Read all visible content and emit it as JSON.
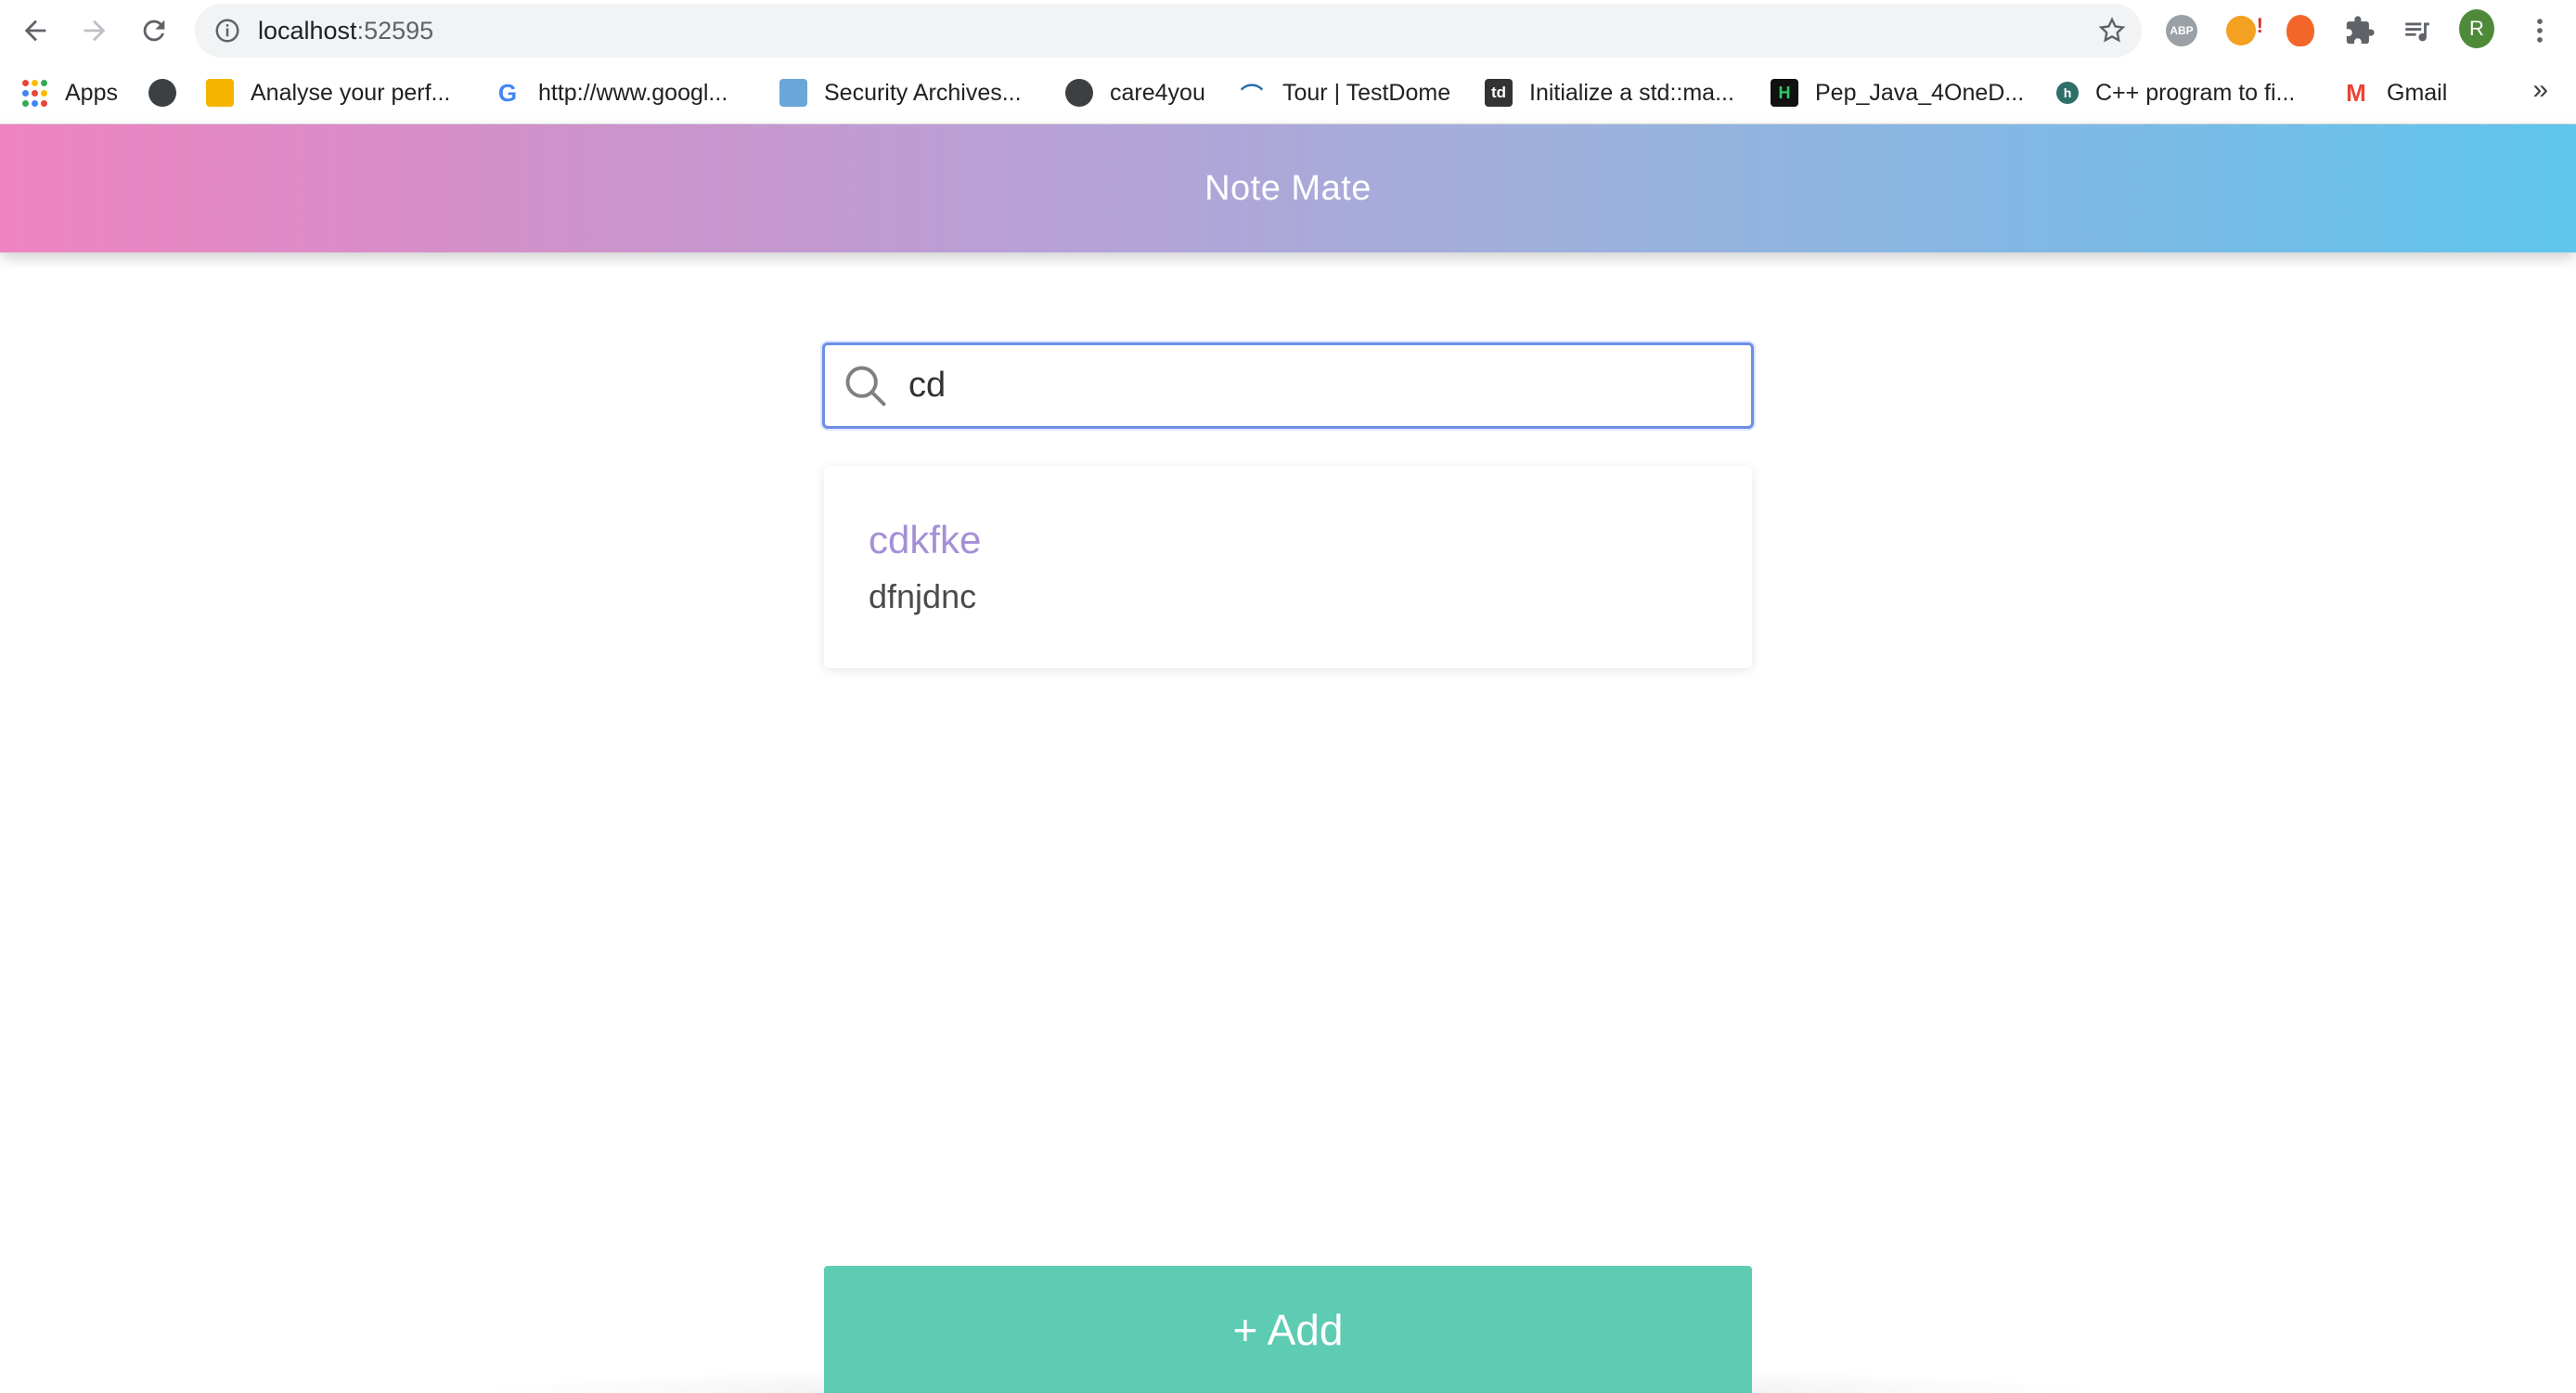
{
  "browser": {
    "url_host": "localhost",
    "url_port": ":52595",
    "profile_initial": "R",
    "extensions": [
      "ABP",
      "key-extension",
      "fire-extension",
      "extensions-puzzle",
      "reading-list"
    ]
  },
  "bookmarks": [
    {
      "label": "Apps",
      "icon": "apps-grid-icon"
    },
    {
      "label": "",
      "icon": "globe-icon"
    },
    {
      "label": "Analyse your perf...",
      "icon": "analytics-icon"
    },
    {
      "label": "http://www.googl...",
      "icon": "google-icon"
    },
    {
      "label": "Security Archives...",
      "icon": "security-icon"
    },
    {
      "label": "care4you",
      "icon": "globe-icon"
    },
    {
      "label": "Tour | TestDome",
      "icon": "testdome-icon"
    },
    {
      "label": "Initialize a std::ma...",
      "icon": "td-icon",
      "icon_text": "td"
    },
    {
      "label": "Pep_Java_4OneD...",
      "icon": "hackerearth-icon",
      "icon_text": "H"
    },
    {
      "label": "C++ program to fi...",
      "icon": "site-icon",
      "icon_text": "h"
    },
    {
      "label": "Gmail",
      "icon": "gmail-icon",
      "icon_text": "M"
    }
  ],
  "app": {
    "title": "Note Mate",
    "search_value": "cd",
    "add_label": "+ Add"
  },
  "notes": [
    {
      "title": "cdkfke",
      "body": "dfnjdnc"
    }
  ],
  "colors": {
    "header_gradient_start": "#ef83c2",
    "header_gradient_end": "#5fc6ec",
    "note_title": "#a48fd6",
    "add_button": "#5ecbb3",
    "search_focus": "#6d8ee8"
  }
}
